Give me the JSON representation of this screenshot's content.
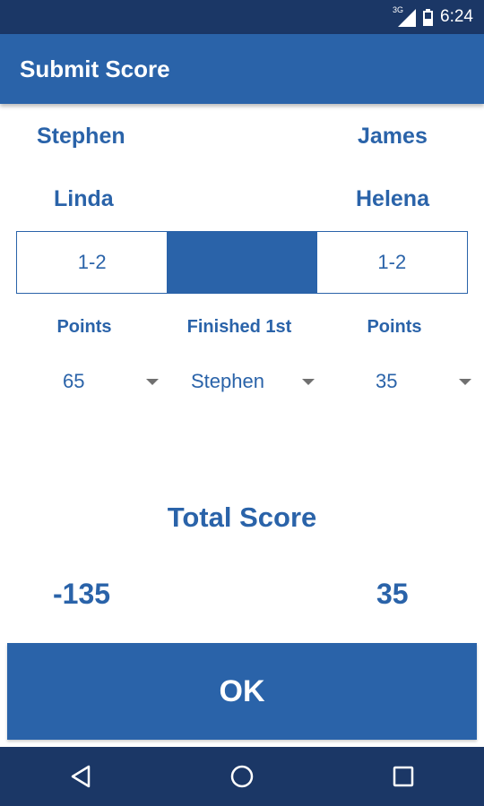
{
  "status_bar": {
    "network": "3G",
    "time": "6:24",
    "icons": [
      "signal-icon",
      "battery-icon"
    ]
  },
  "app_bar": {
    "title": "Submit Score"
  },
  "teams": {
    "left": [
      "Stephen",
      "Linda"
    ],
    "right": [
      "James",
      "Helena"
    ]
  },
  "segments": [
    {
      "label": "1-2",
      "selected": false
    },
    {
      "label": "",
      "selected": true
    },
    {
      "label": "1-2",
      "selected": false
    }
  ],
  "columns": {
    "left_label": "Points",
    "center_label": "Finished 1st",
    "right_label": "Points"
  },
  "spinners": {
    "left_points": "65",
    "finished_first": "Stephen",
    "right_points": "35"
  },
  "total": {
    "title": "Total Score",
    "left_score": "-135",
    "right_score": "35"
  },
  "ok_button": {
    "label": "OK"
  },
  "nav_bar": {
    "icons": [
      "back-icon",
      "home-icon",
      "recents-icon"
    ]
  },
  "colors": {
    "primary": "#2a63a9",
    "dark": "#1b3766",
    "white": "#ffffff"
  }
}
